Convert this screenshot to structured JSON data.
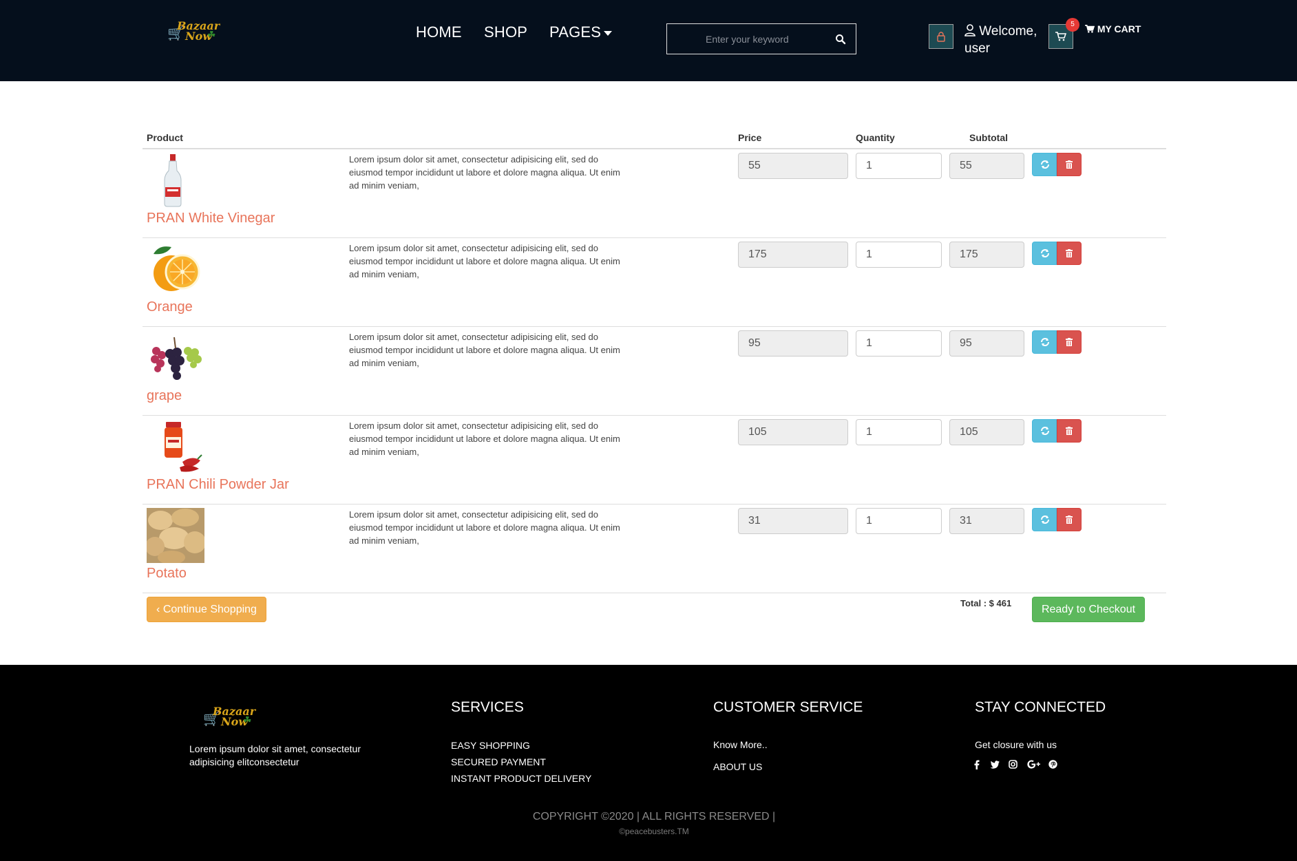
{
  "header": {
    "logo_word1": "Bazaar",
    "logo_word2": "Now",
    "nav": {
      "home": "HOME",
      "shop": "SHOP",
      "pages": "PAGES"
    },
    "search_placeholder": "Enter your keyword",
    "welcome_line1": "Welcome,",
    "welcome_line2": "user",
    "cart_count": "5",
    "my_cart": "MY CART"
  },
  "table": {
    "headers": {
      "product": "Product",
      "price": "Price",
      "quantity": "Quantity",
      "subtotal": "Subtotal"
    },
    "rows": [
      {
        "name": "PRAN White Vinegar",
        "image_icon": "vinegar-bottle-image",
        "description": "Lorem ipsum dolor sit amet, consectetur adipisicing elit, sed do eiusmod tempor incididunt ut labore et dolore magna aliqua. Ut enim ad minim veniam,",
        "price": "55",
        "quantity": "1",
        "subtotal": "55"
      },
      {
        "name": "Orange",
        "image_icon": "orange-image",
        "description": "Lorem ipsum dolor sit amet, consectetur adipisicing elit, sed do eiusmod tempor incididunt ut labore et dolore magna aliqua. Ut enim ad minim veniam,",
        "price": "175",
        "quantity": "1",
        "subtotal": "175"
      },
      {
        "name": "grape",
        "image_icon": "grape-image",
        "description": "Lorem ipsum dolor sit amet, consectetur adipisicing elit, sed do eiusmod tempor incididunt ut labore et dolore magna aliqua. Ut enim ad minim veniam,",
        "price": "95",
        "quantity": "1",
        "subtotal": "95"
      },
      {
        "name": "PRAN Chili Powder Jar",
        "image_icon": "chili-jar-image",
        "description": "Lorem ipsum dolor sit amet, consectetur adipisicing elit, sed do eiusmod tempor incididunt ut labore et dolore magna aliqua. Ut enim ad minim veniam,",
        "price": "105",
        "quantity": "1",
        "subtotal": "105"
      },
      {
        "name": "Potato",
        "image_icon": "potato-image",
        "description": "Lorem ipsum dolor sit amet, consectetur adipisicing elit, sed do eiusmod tempor incididunt ut labore et dolore magna aliqua. Ut enim ad minim veniam,",
        "price": "31",
        "quantity": "1",
        "subtotal": "31"
      }
    ],
    "continue_label": "Continue Shopping",
    "total_label": "Total : $ 461",
    "checkout_label": "Ready to Checkout"
  },
  "footer": {
    "about_text": "Lorem ipsum dolor sit amet, consectetur adipisicing elitconsectetur",
    "services": {
      "title": "SERVICES",
      "items": [
        "EASY SHOPPING",
        "SECURED PAYMENT",
        "INSTANT PRODUCT DELIVERY"
      ]
    },
    "customer_service": {
      "title": "CUSTOMER SERVICE",
      "items": [
        "Know More..",
        "ABOUT US"
      ]
    },
    "stay_connected": {
      "title": "STAY CONNECTED",
      "text": "Get closure with us",
      "icons": [
        "facebook-icon",
        "twitter-icon",
        "instagram-icon",
        "google-plus-icon",
        "pinterest-icon"
      ]
    },
    "copyright": "COPYRIGHT ©2020 | ALL RIGHTS RESERVED |",
    "credit": "©peacebusters.TM"
  },
  "colors": {
    "navbar_bg": "#050f1c",
    "product_name": "#e8745a",
    "refresh_button": "#5bc0de",
    "delete_button": "#d9534f",
    "continue_button": "#f0ad4e",
    "checkout_button": "#5cb85c",
    "cart_badge": "#e53935"
  }
}
